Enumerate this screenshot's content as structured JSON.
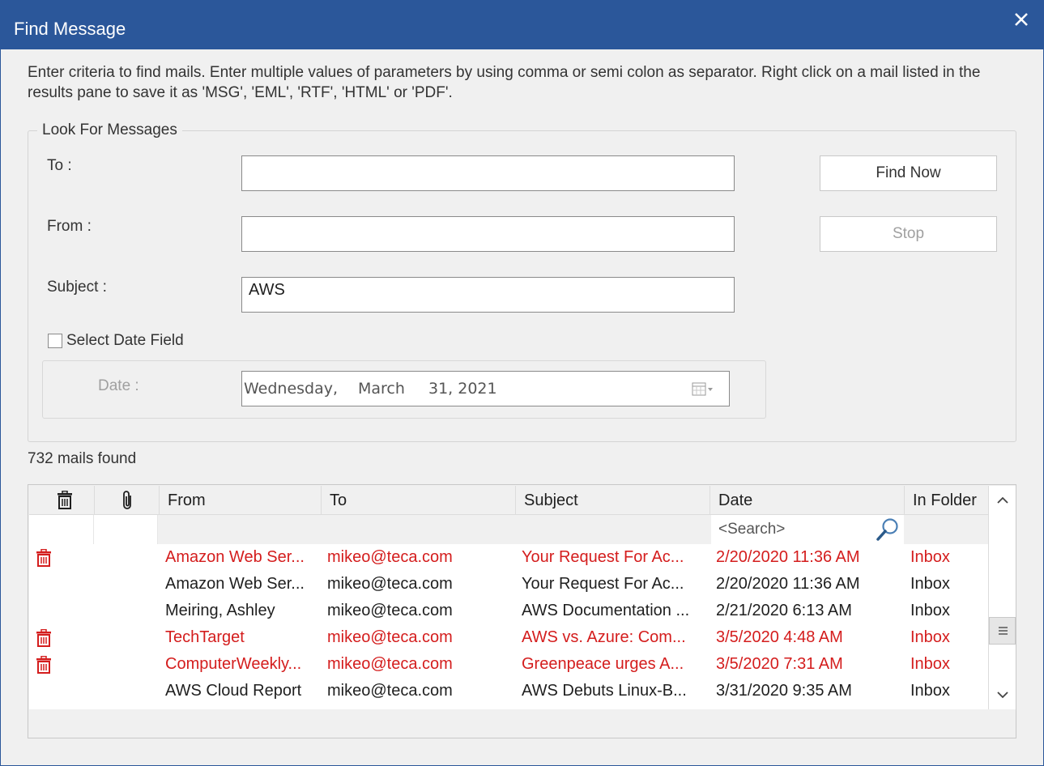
{
  "window": {
    "title": "Find Message"
  },
  "instructions": "Enter criteria to find mails. Enter multiple values of parameters by using comma or semi colon as separator. Right click on a mail listed in the results pane to save it as 'MSG', 'EML', 'RTF', 'HTML' or 'PDF'.",
  "criteria": {
    "legend": "Look For Messages",
    "to_label": "To :",
    "to_value": "",
    "from_label": "From :",
    "from_value": "",
    "subject_label": "Subject :",
    "subject_value": "AWS",
    "date_checkbox_label": "Select Date Field",
    "date_checked": false,
    "date_label": "Date :",
    "date_weekday": "Wednesday,",
    "date_month": "March",
    "date_day_year": "31, 2021"
  },
  "buttons": {
    "find_now": "Find Now",
    "stop": "Stop"
  },
  "results": {
    "count_text": "732 mails found",
    "columns": {
      "from": "From",
      "to": "To",
      "subject": "Subject",
      "date": "Date",
      "folder": "In Folder"
    },
    "date_search_placeholder": "<Search>",
    "rows": [
      {
        "deleted": true,
        "from": "Amazon Web Ser...",
        "to": "mikeo@teca.com",
        "subject": "Your Request For Ac...",
        "date": "2/20/2020 11:36 AM",
        "folder": "Inbox"
      },
      {
        "deleted": false,
        "from": "Amazon Web Ser...",
        "to": "mikeo@teca.com",
        "subject": "Your Request For Ac...",
        "date": "2/20/2020 11:36 AM",
        "folder": "Inbox"
      },
      {
        "deleted": false,
        "from": "Meiring, Ashley",
        "to": "mikeo@teca.com",
        "subject": "AWS Documentation ...",
        "date": "2/21/2020 6:13 AM",
        "folder": "Inbox"
      },
      {
        "deleted": true,
        "from": "TechTarget",
        "to": "mikeo@teca.com",
        "subject": "AWS vs. Azure: Com...",
        "date": "3/5/2020 4:48 AM",
        "folder": "Inbox"
      },
      {
        "deleted": true,
        "from": "ComputerWeekly...",
        "to": "mikeo@teca.com",
        "subject": "Greenpeace urges A...",
        "date": "3/5/2020 7:31 AM",
        "folder": "Inbox"
      },
      {
        "deleted": false,
        "from": "AWS Cloud Report",
        "to": "mikeo@teca.com",
        "subject": "AWS Debuts Linux-B...",
        "date": "3/31/2020 9:35 AM",
        "folder": "Inbox"
      }
    ]
  },
  "colors": {
    "titlebar": "#2b579a",
    "deleted_row": "#d41d1d",
    "normal_row": "#1f1f1f"
  },
  "icons": {
    "close": "close-icon",
    "trash": "trash-icon",
    "attachment": "paperclip-icon",
    "search": "search-icon",
    "calendar": "calendar-icon"
  }
}
